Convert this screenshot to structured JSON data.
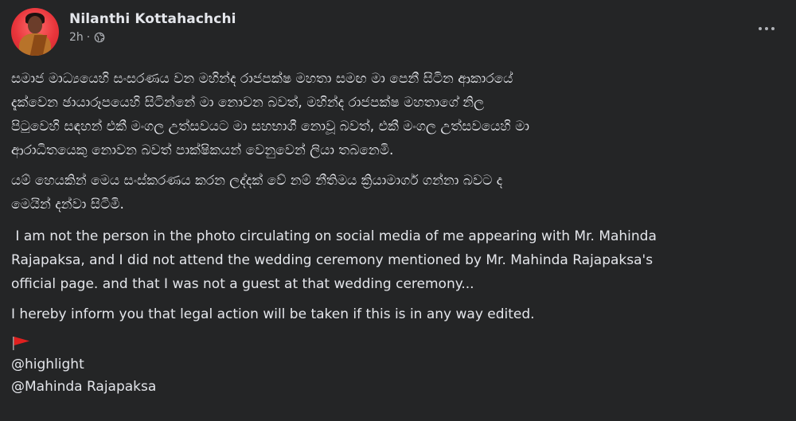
{
  "post": {
    "author": "Nilanthi Kottahachchi",
    "time": "2h",
    "separator": "·",
    "privacy_icon": "globe-icon",
    "more_icon": "more-options-icon"
  },
  "body": {
    "sinhala_paragraph_1": [
      "සමාජ මාධ්‍යයෙහි සංසරණය වන මහින්ද රාජපක්ෂ මහතා සමඟ මා පෙනී සිටින ආකාරයේ",
      "දැක්වෙන ඡායාරූපයෙහි සිටින්නේ මා නොවන  බවත්, මහින්ද රාජපක්ෂ මහතාගේ නිල",
      "පිටුවෙහි සඳහන් එකී මංගල උත්සවයට මා සහභාගී නොවූ බවත්, එකී මංගල උත්සවයෙහි මා",
      "ආරාධිතයෙකු නොවන බවත් පාක්ෂිකයන් වෙනුවෙන් ලියා තබනෙමි."
    ],
    "sinhala_paragraph_2": [
      "යම් හෙයකින් මෙය සංස්කරණය  කරන ලද්දක් වේ නම් නීතිමය ක්‍රියාමාර්ග ගන්නා බවට ද",
      "මෙයින් දන්වා සිටිමි."
    ],
    "english_paragraph_1": [
      " I am not the person in the photo circulating on social media of me appearing with Mr. Mahinda",
      "Rajapaksa, and I did not attend the wedding ceremony mentioned by Mr. Mahinda Rajapaksa's",
      "official page. and that I was not a guest at that wedding ceremony..."
    ],
    "english_paragraph_2": "I hereby inform you that legal action will be taken if this is in any way edited.",
    "flag_icon": "triangular-flag-icon",
    "mentions": [
      "@highlight",
      "@Mahinda Rajapaksa"
    ]
  },
  "colors": {
    "background": "#242526",
    "primary_text": "#e4e6eb",
    "secondary_text": "#b0b3b8",
    "flag_red": "#e0201f"
  }
}
